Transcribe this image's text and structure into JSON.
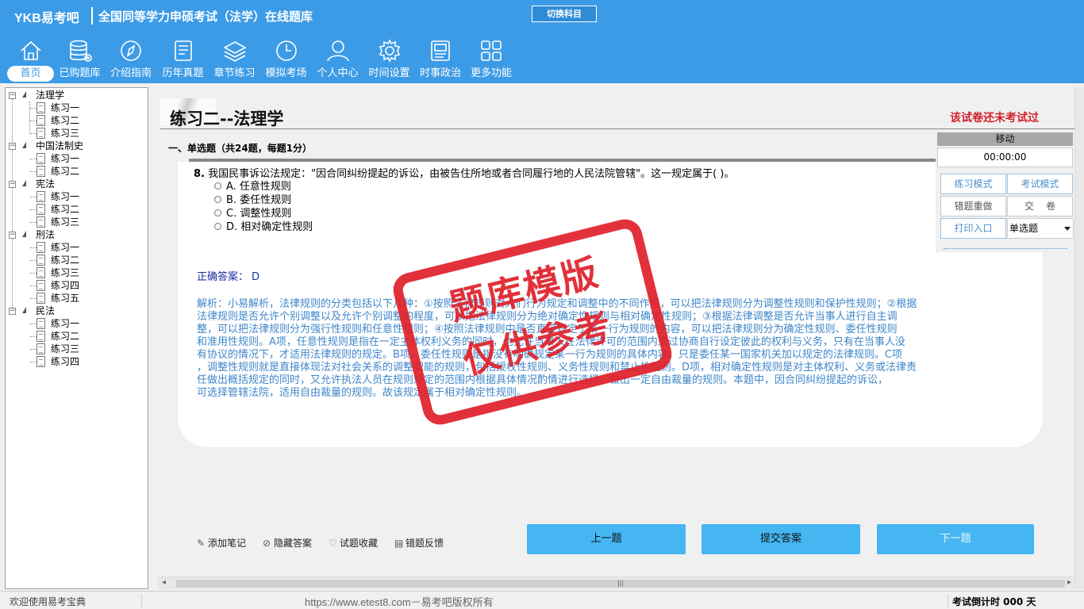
{
  "header": {
    "logo": "YKB易考吧",
    "title": "全国同等学力申硕考试（法学）在线题库",
    "switch_button": "切换科目",
    "nav": [
      {
        "label": "首页",
        "icon": "home-icon",
        "active": true
      },
      {
        "label": "已购题库",
        "icon": "database-icon"
      },
      {
        "label": "介绍指南",
        "icon": "compass-icon"
      },
      {
        "label": "历年真题",
        "icon": "document-list-icon"
      },
      {
        "label": "章节练习",
        "icon": "layers-icon"
      },
      {
        "label": "模拟考场",
        "icon": "clock-icon"
      },
      {
        "label": "个人中心",
        "icon": "user-icon"
      },
      {
        "label": "时间设置",
        "icon": "gear-icon"
      },
      {
        "label": "时事政治",
        "icon": "news-icon"
      },
      {
        "label": "更多功能",
        "icon": "grid-icon"
      }
    ]
  },
  "tree": [
    {
      "label": "法理学",
      "children": [
        "练习一",
        "练习二",
        "练习三"
      ]
    },
    {
      "label": "中国法制史",
      "children": [
        "练习一",
        "练习二"
      ]
    },
    {
      "label": "宪法",
      "children": [
        "练习一",
        "练习二",
        "练习三"
      ]
    },
    {
      "label": "刑法",
      "children": [
        "练习一",
        "练习二",
        "练习三",
        "练习四",
        "练习五"
      ]
    },
    {
      "label": "民法",
      "children": [
        "练习一",
        "练习二",
        "练习三",
        "练习四"
      ]
    }
  ],
  "main": {
    "page_title": "练习二--法理学",
    "status_notice": "该试卷还未考试过",
    "section_header": "一、单选题（共24题，每题1分）",
    "question": {
      "number": "8.",
      "text": "我国民事诉讼法规定：\"因合同纠纷提起的诉讼，由被告住所地或者合同履行地的人民法院管辖\"。这一规定属于( )。",
      "options": [
        "A. 任意性规则",
        "B. 委任性规则",
        "C. 调整性规则",
        "D. 相对确定性规则"
      ]
    },
    "answer_label": "正确答案：",
    "answer_value": "D",
    "explanation_lines": [
      "解析：小易解析，法律规则的分类包括以下几种：①按照法律规则对人们行为规定和调整中的不同作用，可以把法律规则分为调整性规则和保护性规则；②根据",
      "法律规则是否允许个别调整以及允许个别调整的程度，可以把法律规则分为绝对确定性规则与相对确定性规则；③根据法律调整是否允许当事人进行自主调",
      "整，可以把法律规则分为强行性规则和任意性规则；④按照法律规则中是否直接规定了某一行为规则的内容，可以把法律规则分为确定性规则、委任性规则",
      "和准用性规则。A项，任意性规则是指在一定主体权利义务的同时，也允许当事人在法律许可的范围内通过协商自行设定彼此的权利与义务，只有在当事人没",
      "有协议的情况下，才适用法律规则的规定。B项，委任性规则是指没有明确规定某一行为规则的具体内容，只是委任某一国家机关加以规定的法律规则。C项",
      "，调整性规则就是直接体现法对社会关系的调整职能的规则，包括授权性规则、义务性规则和禁止性规则。D项，相对确定性规则是对主体权利、义务或法律责",
      "任做出概括规定的同时，又允许执法人员在规则规定的范围内根据具体情况酌情进行选择，做出一定自由裁量的规则。本题中，因合同纠纷提起的诉讼，",
      "可选择管辖法院，适用自由裁量的规则。故该规定属于相对确定性规则。"
    ],
    "stamp_line1": "题库模版",
    "stamp_line2": "仅供参考"
  },
  "controls": {
    "move_label": "移动",
    "timer": "00:00:00",
    "practice_mode": "练习模式",
    "exam_mode": "考试模式",
    "redo_wrong": "错题重做",
    "submit_paper": "交    卷",
    "print_entry": "打印入口",
    "question_type_selected": "单选题"
  },
  "tools": [
    {
      "label": "添加笔记",
      "icon": "pencil-icon",
      "glyph": "✎"
    },
    {
      "label": "隐藏答案",
      "icon": "eye-slash-icon",
      "glyph": "⊘"
    },
    {
      "label": "试题收藏",
      "icon": "heart-icon",
      "glyph": "♡"
    },
    {
      "label": "错题反馈",
      "icon": "feedback-icon",
      "glyph": "▤"
    }
  ],
  "buttons": {
    "prev": "上一题",
    "submit_answer": "提交答案",
    "next": "下一题"
  },
  "status_bar": {
    "welcome": "欢迎使用易考宝典",
    "website": "https://www.etest8.com－易考吧版权所有",
    "countdown": "考试倒计时 000 天"
  }
}
